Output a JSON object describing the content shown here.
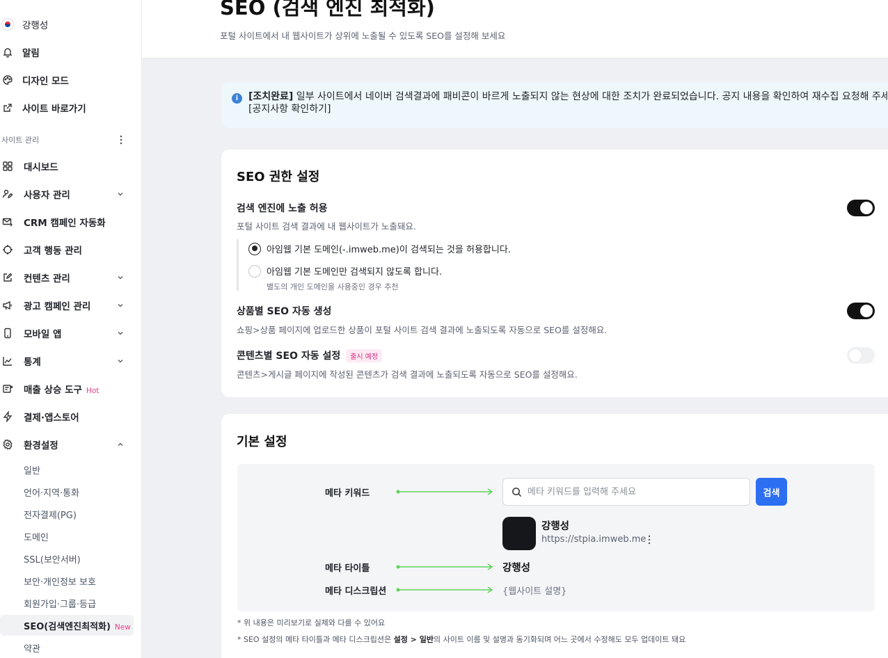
{
  "sidebar": {
    "user_name": "강행성",
    "top_items": [
      {
        "label": "알림",
        "icon": "bell-icon"
      },
      {
        "label": "디자인 모드",
        "icon": "palette-icon"
      },
      {
        "label": "사이트 바로가기",
        "icon": "external-link-icon"
      }
    ],
    "section_label": "사이트 관리",
    "items": [
      {
        "label": "대시보드",
        "icon": "grid-icon"
      },
      {
        "label": "사용자 관리",
        "icon": "user-edit-icon",
        "chevron": "down"
      },
      {
        "label": "CRM 캠페인 자동화",
        "icon": "mail-auto-icon"
      },
      {
        "label": "고객 행동 관리",
        "icon": "target-icon"
      },
      {
        "label": "컨텐츠 관리",
        "icon": "pencil-square-icon",
        "chevron": "down"
      },
      {
        "label": "광고 캠페인 관리",
        "icon": "megaphone-icon",
        "chevron": "down"
      },
      {
        "label": "모바일 앱",
        "icon": "mobile-icon",
        "chevron": "down"
      },
      {
        "label": "통계",
        "icon": "chart-line-icon",
        "chevron": "down"
      },
      {
        "label": "매출 상승 도구",
        "icon": "sales-tool-icon",
        "tag": "Hot"
      },
      {
        "label": "결제·앱스토어",
        "icon": "bolt-icon"
      },
      {
        "label": "환경설정",
        "icon": "gear-icon",
        "chevron": "up"
      }
    ],
    "settings_sub": [
      {
        "label": "일반"
      },
      {
        "label": "언어·지역·통화"
      },
      {
        "label": "전자결제(PG)"
      },
      {
        "label": "도메인"
      },
      {
        "label": "SSL(보안서버)"
      },
      {
        "label": "보안·개인정보 보호"
      },
      {
        "label": "회원가입·그룹·등급"
      },
      {
        "label": "SEO(검색엔진최적화)",
        "tag": "New",
        "active": true
      },
      {
        "label": "약관"
      }
    ]
  },
  "header": {
    "title": "SEO (검색 엔진 최적화)",
    "subtitle": "포털 사이트에서 내 웹사이트가 상위에 노출될 수 있도록 SEO를 설정해 보세요"
  },
  "notice": {
    "icon": "info-icon",
    "bold": "[조치완료]",
    "text": " 일부 사이트에서 네이버 검색결과에 패비콘이 바르게 노출되지 않는 현상에 대한 조치가 완료되었습니다. 공지 내용을 확인하여 재수집 요청해 주세요. [공지사항 확인하기]"
  },
  "seo_permission": {
    "title": "SEO 권한 설정",
    "options": [
      {
        "title": "검색 엔진에 노출 허용",
        "desc": "포털 사이트 검색 결과에 내 웹사이트가 노출돼요.",
        "enabled": true
      },
      {
        "title": "상품별 SEO 자동 생성",
        "desc": "쇼핑>상품 페이지에 업로드한 상품이 포털 사이트 검색 결과에 노출되도록 자동으로 SEO를 설정해요.",
        "enabled": true
      },
      {
        "title": "콘텐츠별 SEO 자동 설정",
        "badge": "출시 예정",
        "desc": "콘텐츠>게시글 페이지에 작성된 콘텐츠가 검색 결과에 노출되도록 자동으로 SEO를 설정해요.",
        "enabled": false
      }
    ],
    "radios": [
      {
        "label": "아임웹 기본 도메인(-.imweb.me)이 검색되는 것을 허용합니다.",
        "selected": true
      },
      {
        "label": "아임웹 기본 도메인만 검색되지 않도록 합니다.",
        "selected": false
      }
    ],
    "radio_note": "별도의 개인 도메인을 사용중인 경우 추천"
  },
  "basic_settings": {
    "title": "기본 설정",
    "meta_keyword_label": "메타 키워드",
    "meta_title_label": "메타 타이틀",
    "meta_desc_label": "메타 디스크립션",
    "search_placeholder": "메타 키워드를 입력해 주세요",
    "search_button": "검색",
    "site_name": "강행성",
    "site_url": "https://stpia.imweb.me",
    "meta_title_value": "강행성",
    "meta_desc_value": "{웹사이트 설명}",
    "footnote1": "* 위 내용은 미리보기로 실제와 다를 수 있어요",
    "footnote2_pre": "* SEO 설정의 메타 타이틀과 메타 디스크립션은 ",
    "footnote2_bold": "설정 > 일반",
    "footnote2_post": "의 사이트 이름 및 설명과 동기화되며 어느 곳에서 수정해도 모두 업데이트 돼요",
    "arrow_color": "#5fd35a"
  },
  "colors": {
    "accent": "#2c6ff1",
    "hot_new": "#e8408e",
    "toggle_on": "#111111"
  }
}
